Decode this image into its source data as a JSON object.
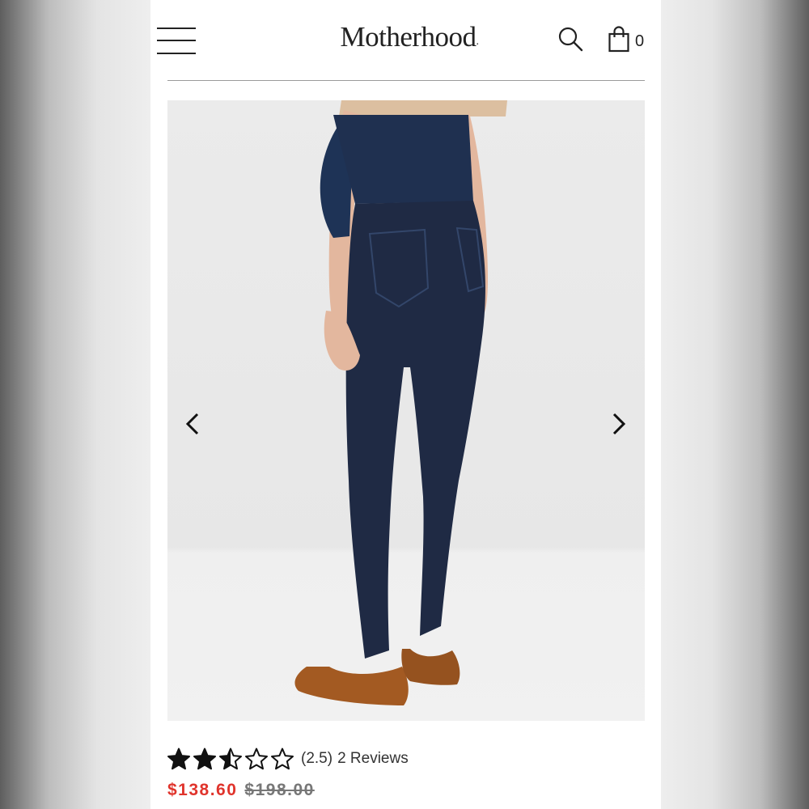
{
  "header": {
    "brand": "Motherhood",
    "brand_mark": ".",
    "cart_count": "0"
  },
  "product": {
    "image_icon": "maternity-jeans-photo",
    "rating_value": 2.5,
    "rating_max": 5,
    "rating_text": "(2.5)",
    "reviews_text": "2 Reviews",
    "sale_price": "$138.60",
    "original_price": "$198.00"
  },
  "icons": {
    "menu": "hamburger-icon",
    "search": "search-icon",
    "cart": "shopping-bag-icon",
    "prev": "chevron-left-icon",
    "next": "chevron-right-icon"
  },
  "colors": {
    "sale": "#e0342c",
    "original": "#777777",
    "text": "#222222",
    "denim": "#1f2a44"
  }
}
